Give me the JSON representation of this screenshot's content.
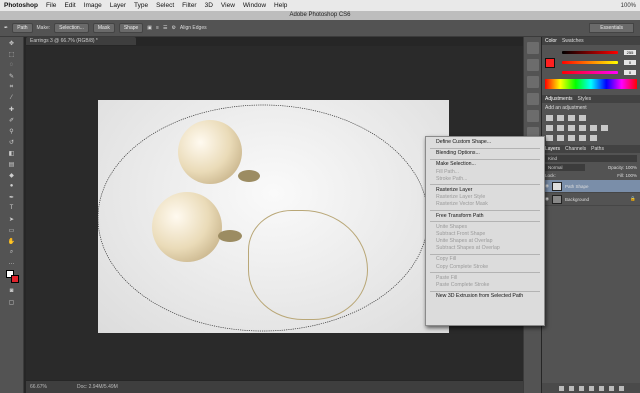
{
  "menubar": {
    "app": "Photoshop",
    "items": [
      "File",
      "Edit",
      "Image",
      "Layer",
      "Type",
      "Select",
      "Filter",
      "3D",
      "View",
      "Window",
      "Help"
    ],
    "right": "100%"
  },
  "window_title": "Adobe Photoshop CS6",
  "options": {
    "path": "Path",
    "make": "Make:",
    "selection": "Selection...",
    "mask": "Mask",
    "shape": "Shape",
    "align_edges": "Align Edges",
    "workspace": "Essentials"
  },
  "doc_tab": "Earrings 3 @ 66.7% (RGB/8) *",
  "status": {
    "zoom": "66.67%",
    "doc": "Doc: 2.94M/5.49M"
  },
  "panels": {
    "color_tabs": [
      "Color",
      "Swatches"
    ],
    "rgb": [
      "255",
      "0",
      "0"
    ],
    "adj_tabs": [
      "Adjustments",
      "Styles"
    ],
    "adj_title": "Add an adjustment",
    "layer_tabs": [
      "Layers",
      "Channels",
      "Paths"
    ],
    "kind": "Kind",
    "blend": "Normal",
    "opacity": "Opacity: 100%",
    "lock": "Lock:",
    "fill": "Fill: 100%",
    "layers": [
      {
        "name": "Path Shape",
        "selected": true
      },
      {
        "name": "Background",
        "selected": false
      }
    ]
  },
  "context_menu": {
    "groups": [
      [
        {
          "label": "Define Custom Shape...",
          "enabled": true
        }
      ],
      [
        {
          "label": "Blending Options...",
          "enabled": true
        }
      ],
      [
        {
          "label": "Make Selection...",
          "enabled": true
        },
        {
          "label": "Fill Path...",
          "enabled": false
        },
        {
          "label": "Stroke Path...",
          "enabled": false
        }
      ],
      [
        {
          "label": "Rasterize Layer",
          "enabled": true
        },
        {
          "label": "Rasterize Layer Style",
          "enabled": false
        },
        {
          "label": "Rasterize Vector Mask",
          "enabled": false
        }
      ],
      [
        {
          "label": "Free Transform Path",
          "enabled": true
        }
      ],
      [
        {
          "label": "Unite Shapes",
          "enabled": false
        },
        {
          "label": "Subtract Front Shape",
          "enabled": false
        },
        {
          "label": "Unite Shapes at Overlap",
          "enabled": false
        },
        {
          "label": "Subtract Shapes at Overlap",
          "enabled": false
        }
      ],
      [
        {
          "label": "Copy Fill",
          "enabled": false
        },
        {
          "label": "Copy Complete Stroke",
          "enabled": false
        }
      ],
      [
        {
          "label": "Paste Fill",
          "enabled": false
        },
        {
          "label": "Paste Complete Stroke",
          "enabled": false
        }
      ],
      [
        {
          "label": "New 3D Extrusion from Selected Path",
          "enabled": true
        }
      ]
    ]
  }
}
